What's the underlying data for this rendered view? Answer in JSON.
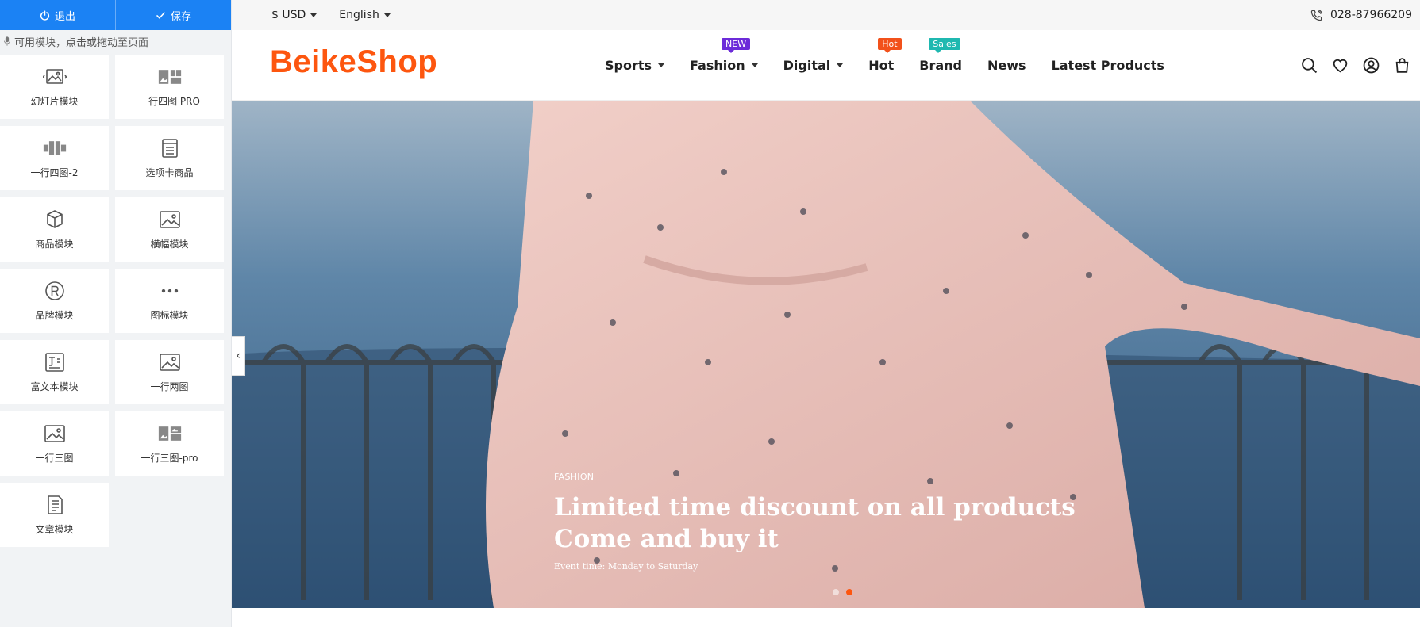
{
  "editor": {
    "exit_label": "退出",
    "save_label": "保存",
    "hint": "可用模块，点击或拖动至页面",
    "modules": [
      {
        "label": "幻灯片模块",
        "icon": "slideshow-icon"
      },
      {
        "label": "一行四图 PRO",
        "icon": "four-images-pro-icon"
      },
      {
        "label": "一行四图-2",
        "icon": "four-images-icon"
      },
      {
        "label": "选项卡商品",
        "icon": "tab-products-icon"
      },
      {
        "label": "商品模块",
        "icon": "cube-icon"
      },
      {
        "label": "横幅模块",
        "icon": "banner-image-icon"
      },
      {
        "label": "品牌模块",
        "icon": "registered-icon"
      },
      {
        "label": "图标模块",
        "icon": "more-dots-icon"
      },
      {
        "label": "富文本模块",
        "icon": "rich-text-icon"
      },
      {
        "label": "一行两图",
        "icon": "two-images-icon"
      },
      {
        "label": "一行三图",
        "icon": "three-images-icon"
      },
      {
        "label": "一行三图-pro",
        "icon": "three-images-pro-icon"
      },
      {
        "label": "文章模块",
        "icon": "article-icon"
      }
    ],
    "collapse_glyph": "‹"
  },
  "topbar": {
    "currency": "$ USD",
    "language": "English",
    "phone": "028-87966209"
  },
  "header": {
    "logo": "BeikeShop",
    "nav": [
      {
        "label": "Sports",
        "has_dropdown": true,
        "badge": null
      },
      {
        "label": "Fashion",
        "has_dropdown": true,
        "badge": "NEW",
        "badge_color": "#6c2bd9"
      },
      {
        "label": "Digital",
        "has_dropdown": true,
        "badge": null
      },
      {
        "label": "Hot",
        "has_dropdown": false,
        "badge": "Hot",
        "badge_color": "#f2511b"
      },
      {
        "label": "Brand",
        "has_dropdown": false,
        "badge": "Sales",
        "badge_color": "#1fb8b0"
      },
      {
        "label": "News",
        "has_dropdown": false,
        "badge": null
      },
      {
        "label": "Latest Products",
        "has_dropdown": false,
        "badge": null
      }
    ]
  },
  "hero": {
    "tag": "FASHION",
    "title_line1": "Limited time discount on all products",
    "title_line2": "Come and buy it",
    "subtitle": "Event time: Monday to Saturday",
    "slide_count": 2,
    "active_slide": 2
  },
  "colors": {
    "accent": "#1b82f4",
    "brand": "#fd560f"
  }
}
